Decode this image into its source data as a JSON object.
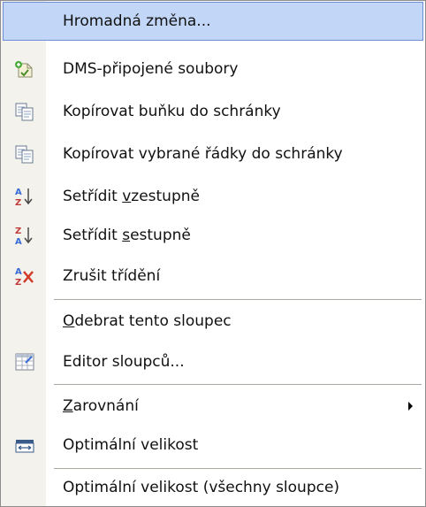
{
  "menu": {
    "items": [
      {
        "label_pre": "",
        "accel": "",
        "label_post": "Hromadná změna..."
      },
      {
        "label_pre": "",
        "accel": "",
        "label_post": "DMS-připojené soubory"
      },
      {
        "label_pre": "",
        "accel": "",
        "label_post": "Kopírovat buňku do schránky"
      },
      {
        "label_pre": "",
        "accel": "",
        "label_post": "Kopírovat vybrané řádky do schránky"
      },
      {
        "label_pre": "Setřídit ",
        "accel": "v",
        "label_post": "zestupně"
      },
      {
        "label_pre": "Setřídit ",
        "accel": "s",
        "label_post": "estupně"
      },
      {
        "label_pre": "",
        "accel": "",
        "label_post": "Zrušit třídění"
      },
      {
        "label_pre": "",
        "accel": "O",
        "label_post": "debrat tento sloupec"
      },
      {
        "label_pre": "",
        "accel": "",
        "label_post": "Editor sloupců..."
      },
      {
        "label_pre": "",
        "accel": "Z",
        "label_post": "arovnání"
      },
      {
        "label_pre": "",
        "accel": "",
        "label_post": "Optimální velikost"
      },
      {
        "label_pre": "",
        "accel": "",
        "label_post": "Optimální velikost (všechny sloupce)"
      }
    ],
    "icons": {
      "dms": "dms-attachment-icon",
      "copy_cell": "copy-icon",
      "copy_rows": "copy-icon",
      "sort_asc": "sort-ascending-icon",
      "sort_desc": "sort-descending-icon",
      "clear_sort": "clear-sort-icon",
      "editor": "column-editor-icon",
      "optimal": "column-width-icon"
    },
    "colors": {
      "highlight": "#c2d6f7",
      "highlight_border": "#6d8ed6",
      "gutter": "#f3f2ec"
    }
  }
}
